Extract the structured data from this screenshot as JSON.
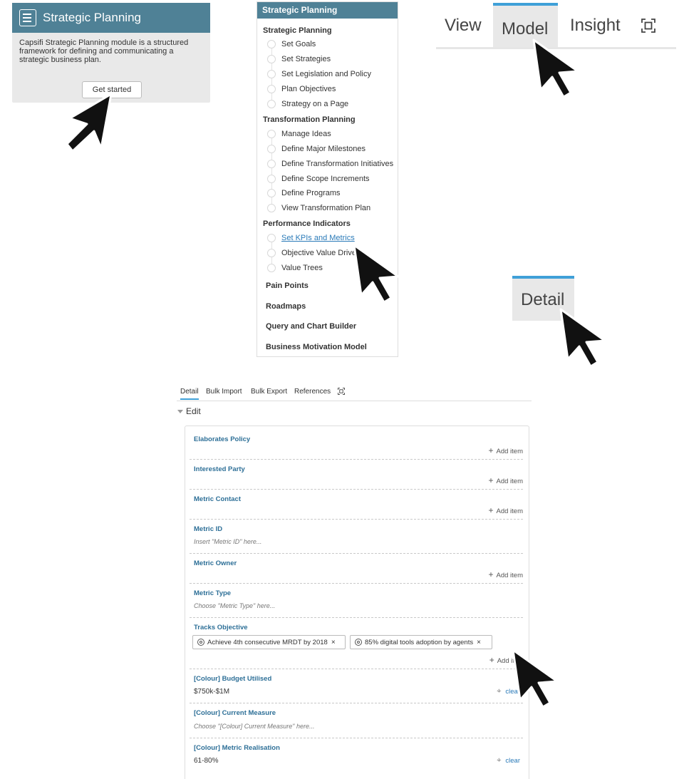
{
  "card": {
    "title": "Strategic Planning",
    "description": "Capsifi Strategic Planning module is a structured framework for defining and communicating a strategic business plan.",
    "button": "Get started"
  },
  "menu": {
    "header": "Strategic Planning",
    "sections": [
      {
        "title": "Strategic Planning",
        "items": [
          "Set Goals",
          "Set Strategies",
          "Set Legislation and Policy",
          "Plan Objectives",
          "Strategy on a Page"
        ]
      },
      {
        "title": "Transformation Planning",
        "items": [
          "Manage Ideas",
          "Define Major Milestones",
          "Define Transformation Initiatives",
          "Define Scope Increments",
          "Define Programs",
          "View Transformation Plan"
        ]
      },
      {
        "title": "Performance Indicators",
        "items": [
          "Set KPIs and Metrics",
          "Objective Value Drive",
          "Value Trees"
        ]
      }
    ],
    "bold_links": [
      "Pain Points",
      "Roadmaps",
      "Query and Chart Builder",
      "Business Motivation Model"
    ]
  },
  "top_tabs": {
    "view": "View",
    "model": "Model",
    "insight": "Insight",
    "expand_icon": "expand-icon"
  },
  "detail_tab": "Detail",
  "subtabs": [
    "Detail",
    "Bulk Import",
    "Bulk Export",
    "References"
  ],
  "edit_heading": "Edit",
  "add_item": "Add item",
  "clear": "clear",
  "fields": {
    "elaborates_policy": "Elaborates Policy",
    "interested_party": "Interested Party",
    "metric_contact": "Metric Contact",
    "metric_id": {
      "label": "Metric ID",
      "placeholder": "Insert \"Metric ID\" here..."
    },
    "metric_owner": "Metric Owner",
    "metric_type": {
      "label": "Metric Type",
      "placeholder": "Choose \"Metric Type\" here..."
    },
    "tracks_objective": {
      "label": "Tracks Objective",
      "chips": [
        "Achieve 4th consecutive MRDT by 2018",
        "85% digital tools adoption by agents"
      ],
      "add_item_partial": "Add it"
    },
    "budget_utilised": {
      "label": "[Colour] Budget Utilised",
      "value": "$750k-$1M"
    },
    "current_measure": {
      "label": "[Colour] Current Measure",
      "placeholder": "Choose \"[Colour] Current Measure\" here..."
    },
    "metric_realisation": {
      "label": "[Colour] Metric Realisation",
      "value": "61-80%"
    }
  },
  "colors": {
    "header_blue": "#4f8196",
    "tab_accent": "#3fa0d8",
    "label_blue": "#2d6f97",
    "link_blue": "#2a7ab8"
  }
}
